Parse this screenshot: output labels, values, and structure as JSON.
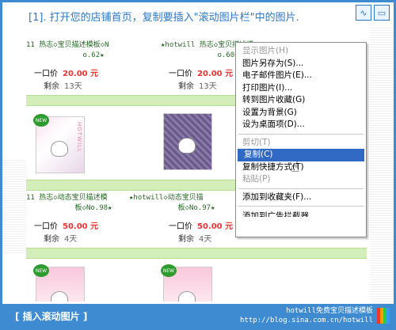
{
  "header": {
    "title": "[1]. 打开您的店铺首页，复制要插入\"滚动图片栏\"中的图片.",
    "btn_left_icon": "wave-icon",
    "btn_right_icon": "window-icon"
  },
  "listings": [
    {
      "title": "11 热志◇宝贝描述模板◇N",
      "sub": "o.62★",
      "price_label": "一口价",
      "price": "20.00 元",
      "remain_label": "剩余",
      "remain": "13天"
    },
    {
      "title": "★hotwill 热志◇宝贝描述模",
      "sub": "o.60★",
      "price_label": "一口价",
      "price": "20.00 元",
      "remain_label": "剩余",
      "remain": "13天"
    },
    {
      "title": "11 热志◇动态宝贝描述模",
      "sub": "板◇No.98★",
      "price_label": "一口价",
      "price": "50.00 元",
      "remain_label": "剩余",
      "remain": "4天"
    },
    {
      "title": "★hotwill◇动态宝贝描",
      "sub": "板◇No.97★",
      "price_label": "一口价",
      "price": "50.00 元",
      "remain_label": "剩余",
      "remain": "4天"
    }
  ],
  "context_menu": {
    "items": [
      {
        "label": "显示图片(H)",
        "disabled": true
      },
      {
        "label": "图片另存为(S)...",
        "disabled": false
      },
      {
        "label": "电子邮件图片(E)...",
        "disabled": false
      },
      {
        "label": "打印图片(I)...",
        "disabled": false
      },
      {
        "label": "转到图片收藏(G)",
        "disabled": false
      },
      {
        "label": "设置为背景(G)",
        "disabled": false
      },
      {
        "label": "设为桌面项(D)...",
        "disabled": false
      },
      {
        "label": "剪切(T)",
        "disabled": true
      },
      {
        "label": "复制(C)",
        "disabled": false,
        "highlighted": true
      },
      {
        "label": "复制快捷方式(T)",
        "disabled": false
      },
      {
        "label": "粘贴(P)",
        "disabled": true
      },
      {
        "label": "添加到收藏夹(F)...",
        "disabled": false
      },
      {
        "label": "添加到广告拦截器",
        "disabled": false
      }
    ]
  },
  "footer": {
    "label": "[ 插入滚动图片 ]",
    "brand": "hotwill免费宝贝描述模板",
    "url": "http://blog.sina.com.cn/hotwill"
  },
  "colors": {
    "accent": "#3f8bd2",
    "price": "#e33333",
    "highlight": "#316ac5"
  }
}
